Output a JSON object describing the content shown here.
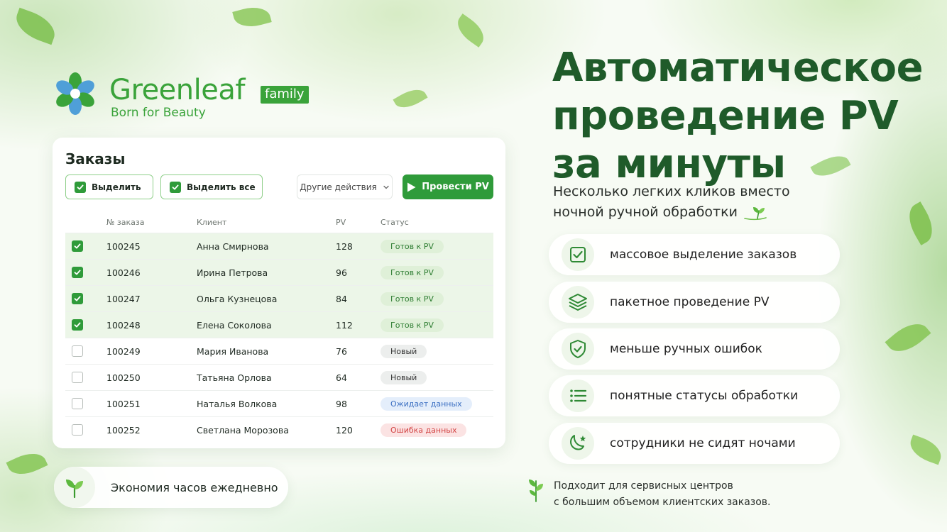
{
  "brand": {
    "name": "Greenleaf",
    "badge": "family",
    "tagline": "Born for Beauty"
  },
  "orders": {
    "title": "Заказы",
    "select_label": "Выделить",
    "select_all_label": "Выделить все",
    "other_actions_label": "Другие действия",
    "run_pv_label": "Провести PV",
    "columns": {
      "number": "№ заказа",
      "client": "Клиент",
      "pv": "PV",
      "status": "Статус"
    },
    "rows": [
      {
        "checked": true,
        "number": "100245",
        "client": "Анна Смирнова",
        "pv": "128",
        "status": "Готов к PV",
        "status_kind": "ready"
      },
      {
        "checked": true,
        "number": "100246",
        "client": "Ирина Петрова",
        "pv": "96",
        "status": "Готов к PV",
        "status_kind": "ready"
      },
      {
        "checked": true,
        "number": "100247",
        "client": "Ольга Кузнецова",
        "pv": "84",
        "status": "Готов к PV",
        "status_kind": "ready"
      },
      {
        "checked": true,
        "number": "100248",
        "client": "Елена Соколова",
        "pv": "112",
        "status": "Готов к PV",
        "status_kind": "ready"
      },
      {
        "checked": false,
        "number": "100249",
        "client": "Мария Иванова",
        "pv": "76",
        "status": "Новый",
        "status_kind": "new"
      },
      {
        "checked": false,
        "number": "100250",
        "client": "Татьяна Орлова",
        "pv": "64",
        "status": "Новый",
        "status_kind": "new"
      },
      {
        "checked": false,
        "number": "100251",
        "client": "Наталья Волкова",
        "pv": "98",
        "status": "Ожидает данных",
        "status_kind": "wait"
      },
      {
        "checked": false,
        "number": "100252",
        "client": "Светлана Морозова",
        "pv": "120",
        "status": "Ошибка данных",
        "status_kind": "error"
      }
    ]
  },
  "savings": {
    "text": "Экономия часов ежедневно"
  },
  "hero": {
    "headline_lines": [
      "Автоматическое",
      "проведение PV",
      "за минуты"
    ],
    "subhead_lines": [
      "Несколько легких кликов вместо",
      "ночной ручной обработки"
    ]
  },
  "features": [
    {
      "icon": "checkbox-icon",
      "text": "массовое выделение заказов"
    },
    {
      "icon": "layers-icon",
      "text": "пакетное проведение PV"
    },
    {
      "icon": "shield-check-icon",
      "text": "меньше ручных ошибок"
    },
    {
      "icon": "list-icon",
      "text": "понятные статусы обработки"
    },
    {
      "icon": "moon-star-icon",
      "text": "сотрудники не сидят ночами"
    }
  ],
  "footnote": {
    "lines": [
      "Подходит для сервисных центров",
      "с большим объемом клиентских заказов."
    ]
  },
  "colors": {
    "brand_green": "#3aa33a",
    "headline_green": "#1f5b2a",
    "primary_button": "#2f9b3a",
    "selected_row": "#ecf6e8",
    "status_ready": "#2e7d32",
    "status_wait": "#3b6fc2",
    "status_error": "#d34545"
  }
}
